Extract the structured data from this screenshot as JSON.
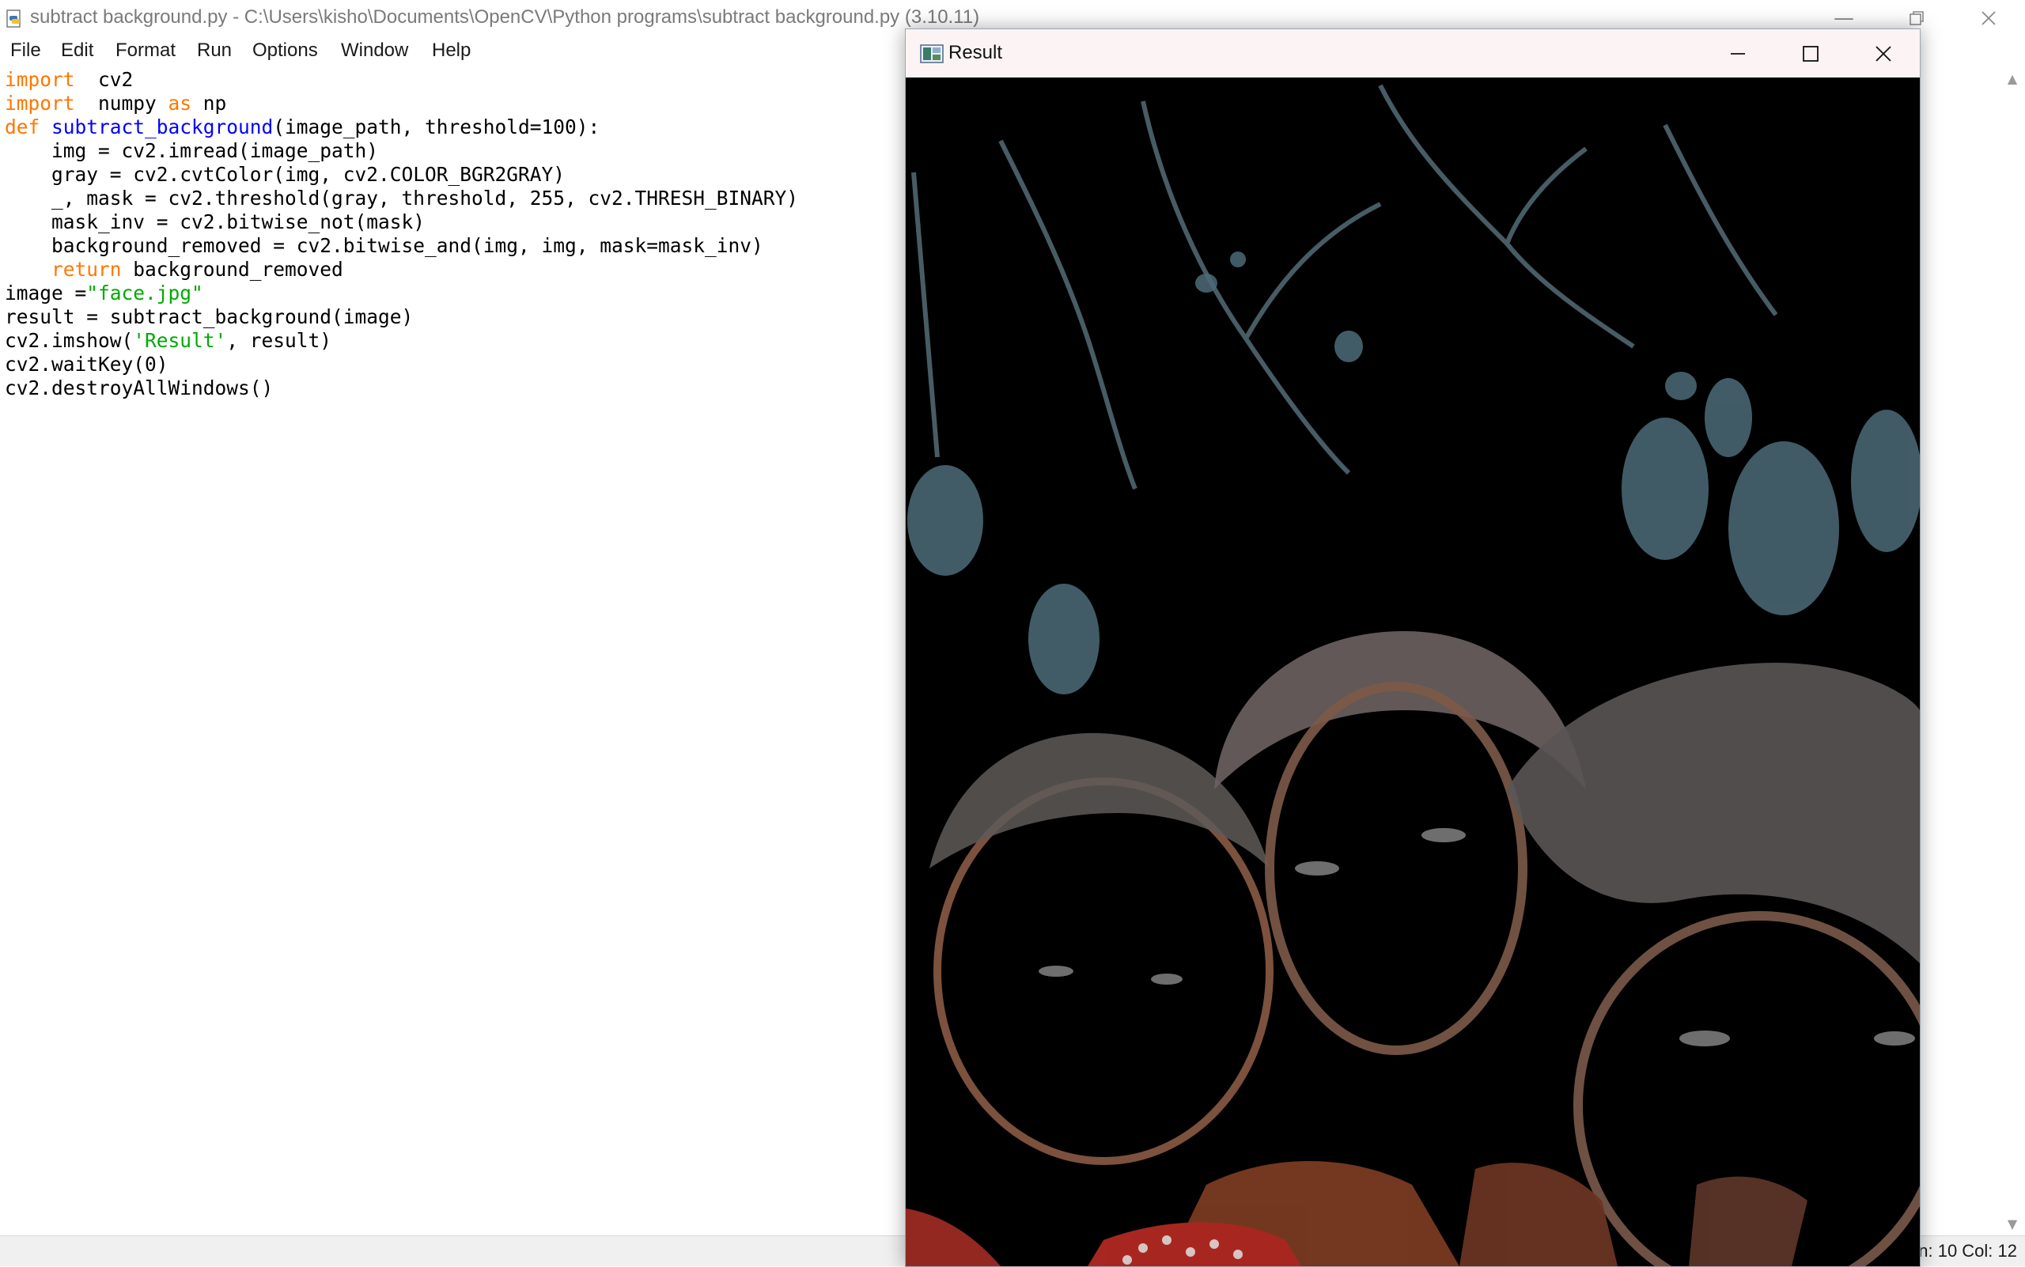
{
  "idle": {
    "title": "subtract background.py - C:\\Users\\kisho\\Documents\\OpenCV\\Python programs\\subtract background.py (3.10.11)",
    "menu": [
      "File",
      "Edit",
      "Format",
      "Run",
      "Options",
      "Window",
      "Help"
    ],
    "status": "n: 10  Col: 12",
    "code_lines": [
      [
        [
          "kw",
          "import"
        ],
        [
          "",
          "  cv2"
        ]
      ],
      [
        [
          "kw",
          "import"
        ],
        [
          "",
          "  numpy "
        ],
        [
          "kw",
          "as"
        ],
        [
          "",
          " np"
        ]
      ],
      [
        [
          "kw",
          "def"
        ],
        [
          "",
          " "
        ],
        [
          "fn",
          "subtract_background"
        ],
        [
          "",
          "(image_path, threshold=100):"
        ]
      ],
      [
        [
          "",
          "    img = cv2.imread(image_path)"
        ]
      ],
      [
        [
          "",
          "    gray = cv2.cvtColor(img, cv2.COLOR_BGR2GRAY)"
        ]
      ],
      [
        [
          "",
          "    _, mask = cv2.threshold(gray, threshold, 255, cv2.THRESH_BINARY)"
        ]
      ],
      [
        [
          "",
          "    mask_inv = cv2.bitwise_not(mask)"
        ]
      ],
      [
        [
          "",
          "    background_removed = cv2.bitwise_and(img, img, mask=mask_inv)"
        ]
      ],
      [
        [
          "kw",
          "    return"
        ],
        [
          "",
          " background_removed"
        ]
      ],
      [
        [
          "",
          "image ="
        ],
        [
          "st",
          "\"face.jpg\""
        ]
      ],
      [
        [
          "",
          "result = subtract_background(image)"
        ]
      ],
      [
        [
          "",
          "cv2.imshow("
        ],
        [
          "st",
          "'Result'"
        ],
        [
          "",
          ", result)"
        ]
      ],
      [
        [
          "",
          "cv2.waitKey(0)"
        ]
      ],
      [
        [
          "",
          "cv2.destroyAllWindows()"
        ]
      ]
    ]
  },
  "result_window": {
    "title": "Result"
  },
  "icons": {
    "python_file": "python-file-icon",
    "minimize": "minimize-icon",
    "maximize": "maximize-icon",
    "restore": "restore-icon",
    "close": "close-icon",
    "opencv_window": "image-window-icon"
  },
  "colors": {
    "keyword": "#ff7700",
    "function": "#0000ff",
    "string": "#00aa00"
  }
}
